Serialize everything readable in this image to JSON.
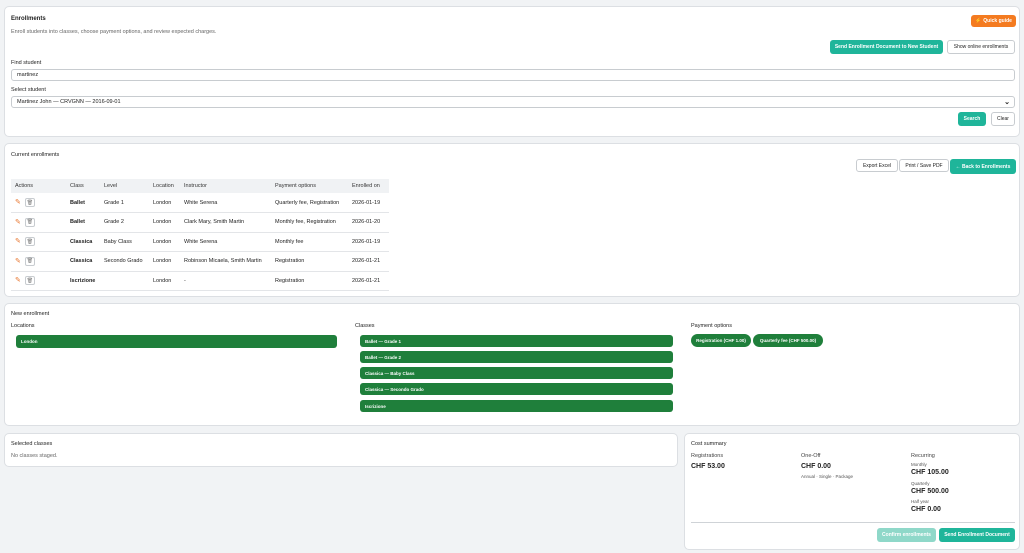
{
  "header": {
    "title": "Enrollments",
    "subtitle": "Enroll students into classes, choose payment options, and review expected charges.",
    "quick_guide": "Quick guide",
    "send_doc_new": "Send Enrollment Document to New Student",
    "show_online": "Show online enrollments",
    "find_label": "Find student",
    "find_value": "martinez",
    "select_label": "Select student",
    "select_value": "Martinez John — CRVGNN — 2016-09-01",
    "search": "Search",
    "clear": "Clear"
  },
  "current": {
    "title": "Current enrollments",
    "export_excel": "Export Excel",
    "print_pdf": "Print / Save PDF",
    "back": "← Back to Enrollments",
    "columns": [
      "Actions",
      "Class",
      "Level",
      "Location",
      "Instructor",
      "Payment options",
      "Enrolled on"
    ],
    "rows": [
      {
        "class": "Ballet",
        "level": "Grade 1",
        "location": "London",
        "instructor": "White Serena",
        "payment": "Quarterly fee, Registration",
        "enrolled": "2026-01-19"
      },
      {
        "class": "Ballet",
        "level": "Grade 2",
        "location": "London",
        "instructor": "Clark Mary, Smith Martin",
        "payment": "Monthly fee, Registration",
        "enrolled": "2026-01-20"
      },
      {
        "class": "Classica",
        "level": "Baby Class",
        "location": "London",
        "instructor": "White Serena",
        "payment": "Monthly fee",
        "enrolled": "2026-01-19"
      },
      {
        "class": "Classica",
        "level": "Secondo Grado",
        "location": "London",
        "instructor": "Robinson Micaela, Smith Martin",
        "payment": "Registration",
        "enrolled": "2026-01-21"
      },
      {
        "class": "Iscrizione",
        "level": "",
        "location": "London",
        "instructor": "-",
        "payment": "Registration",
        "enrolled": "2026-01-21"
      }
    ]
  },
  "new_enrollment": {
    "title": "New enrollment",
    "locations_label": "Locations",
    "locations": [
      "London"
    ],
    "classes_label": "Classes",
    "classes": [
      "Ballet — Grade 1",
      "Ballet — Grade 2",
      "Classica — Baby Class",
      "Classica — Secondo Grado",
      "Iscrizione"
    ],
    "payment_label": "Payment options",
    "payments": [
      "Registration (CHF 1.00)",
      "Quarterly fee (CHF 500.00)"
    ]
  },
  "selected": {
    "title": "Selected classes",
    "empty": "No classes staged."
  },
  "cost": {
    "title": "Cost summary",
    "registrations_label": "Registrations",
    "registrations_amount": "CHF 53.00",
    "oneoff_label": "One-Off",
    "oneoff_amount": "CHF 0.00",
    "oneoff_note": "Annual · Single · Package",
    "recurring_label": "Recurring",
    "monthly_label": "Monthly",
    "monthly_amount": "CHF 105.00",
    "quarterly_label": "Quarterly",
    "quarterly_amount": "CHF 500.00",
    "halfyear_label": "Half year",
    "halfyear_amount": "CHF 0.00",
    "confirm": "Confirm enrollments",
    "send_doc": "Send Enrollment Document"
  },
  "colors": {
    "accent": "#1fb59a",
    "green": "#1f7f3b",
    "orange": "#f47b20"
  }
}
